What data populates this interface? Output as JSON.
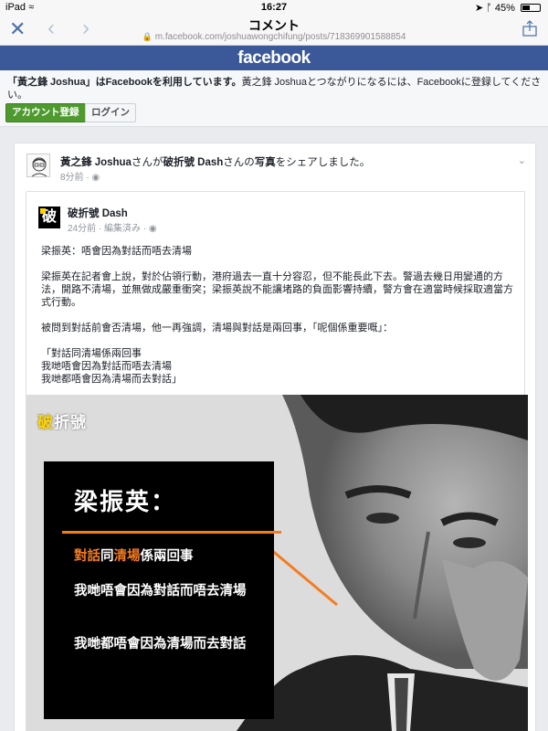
{
  "status_bar": {
    "device": "iPad",
    "wifi_icon": "wifi-icon",
    "time": "16:27",
    "battery_pct": "45%",
    "battery_level": 0.45
  },
  "browser": {
    "title": "コメント",
    "url": "m.facebook.com/joshuawongchifung/posts/718369901588854",
    "close_icon": "close-icon",
    "back_icon": "chevron-left-icon",
    "forward_icon": "chevron-right-icon",
    "share_icon": "share-icon"
  },
  "header": {
    "logo_text": "facebook",
    "brand_color": "#3b5998"
  },
  "signup": {
    "message_name": "「黃之鋒 Joshua」はFacebookを利用しています。",
    "message_rest": "黃之鋒 Joshuaとつながりになるには、Facebookに登録してください。",
    "register_label": "アカウント登録",
    "login_label": "ログイン"
  },
  "post": {
    "author": "黃之鋒 Joshua",
    "action_1": "さんが",
    "shared_from": "破折號 Dash",
    "action_2": "さんの",
    "object": "写真",
    "action_3": "をシェアしました。",
    "time": "8分前",
    "privacy_icon": "globe-icon",
    "options_icon": "chevron-down-icon"
  },
  "shared_post": {
    "page_name": "破折號 Dash",
    "avatar_char": "破",
    "meta": "24分前 · 編集済み ·",
    "paragraphs": [
      "梁振英：唔會因為對話而唔去清場",
      "梁振英在記者會上說，對於佔領行動，港府過去一直十分容忍，但不能長此下去。警過去幾日用變通的方法，開路不清場，並無做成嚴重衝突；梁振英說不能讓堵路的負面影響持續，警方會在適當時候採取適當方式行動。",
      "被問到對話前會否清場，他一再強調，清場與對話是兩回事，「呢個係重要嘅」："
    ],
    "quote_lines": [
      "「對話同清場係兩回事",
      "我哋唔會因為對話而唔去清場",
      "我哋都唔會因為清場而去對話」"
    ]
  },
  "photo": {
    "watermark_a": "破",
    "watermark_b": "折號",
    "headline": "梁振英：",
    "line1_a": "對話",
    "line1_b": "同",
    "line1_c": "清場",
    "line1_d": "係兩回事",
    "line2": "我哋唔會因為對話而唔去清場",
    "line3": "我哋都唔會因為清場而去對話",
    "accent_color": "#f47c20"
  }
}
